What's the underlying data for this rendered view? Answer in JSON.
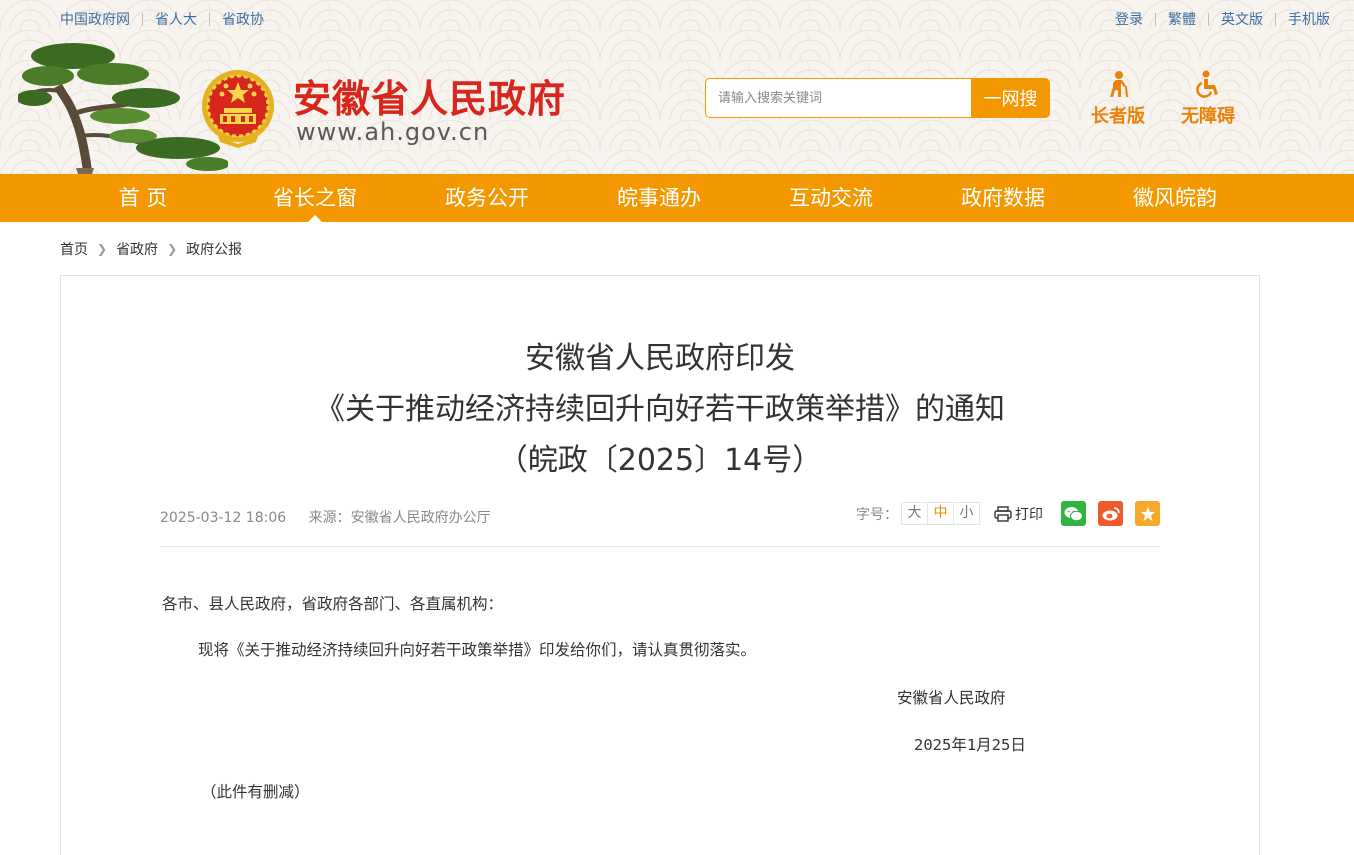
{
  "top_links": {
    "left": [
      "中国政府网",
      "省人大",
      "省政协"
    ],
    "right": [
      "登录",
      "繁體",
      "英文版",
      "手机版"
    ]
  },
  "site": {
    "title": "安徽省人民政府",
    "url": "www.ah.gov.cn"
  },
  "search": {
    "placeholder": "请输入搜索关键词",
    "button": "一网搜"
  },
  "quick": {
    "elderly": "长者版",
    "accessible": "无障碍"
  },
  "nav": {
    "items": [
      "首 页",
      "省长之窗",
      "政务公开",
      "皖事通办",
      "互动交流",
      "政府数据",
      "徽风皖韵"
    ],
    "active_index": 1
  },
  "breadcrumb": [
    "首页",
    "省政府",
    "政府公报"
  ],
  "article": {
    "title_lines": [
      "安徽省人民政府印发",
      "《关于推动经济持续回升向好若干政策举措》的通知",
      "（皖政〔2025〕14号）"
    ],
    "date": "2025-03-12 18:06",
    "source": "来源：安徽省人民政府办公厅",
    "font_size_label": "字号：",
    "font_sizes": [
      "大",
      "中",
      "小"
    ],
    "font_size_selected": "中",
    "print": "打印",
    "salutation": "各市、县人民政府，省政府各部门、各直属机构：",
    "paragraph": "现将《关于推动经济持续回升向好若干政策举措》印发给你们，请认真贯彻落实。",
    "signature": "安徽省人民政府",
    "sign_date": "2025年1月25日",
    "note": "（此件有删减）"
  },
  "colors": {
    "accent": "#f39800",
    "title_red": "#d7261b",
    "link_blue": "#3d6ea5"
  },
  "icons": [
    "pine-tree-image",
    "national-emblem-icon",
    "elderly-icon",
    "wheelchair-icon",
    "print-icon",
    "wechat-icon",
    "weibo-icon",
    "star-icon",
    "chevron-right-icon"
  ]
}
